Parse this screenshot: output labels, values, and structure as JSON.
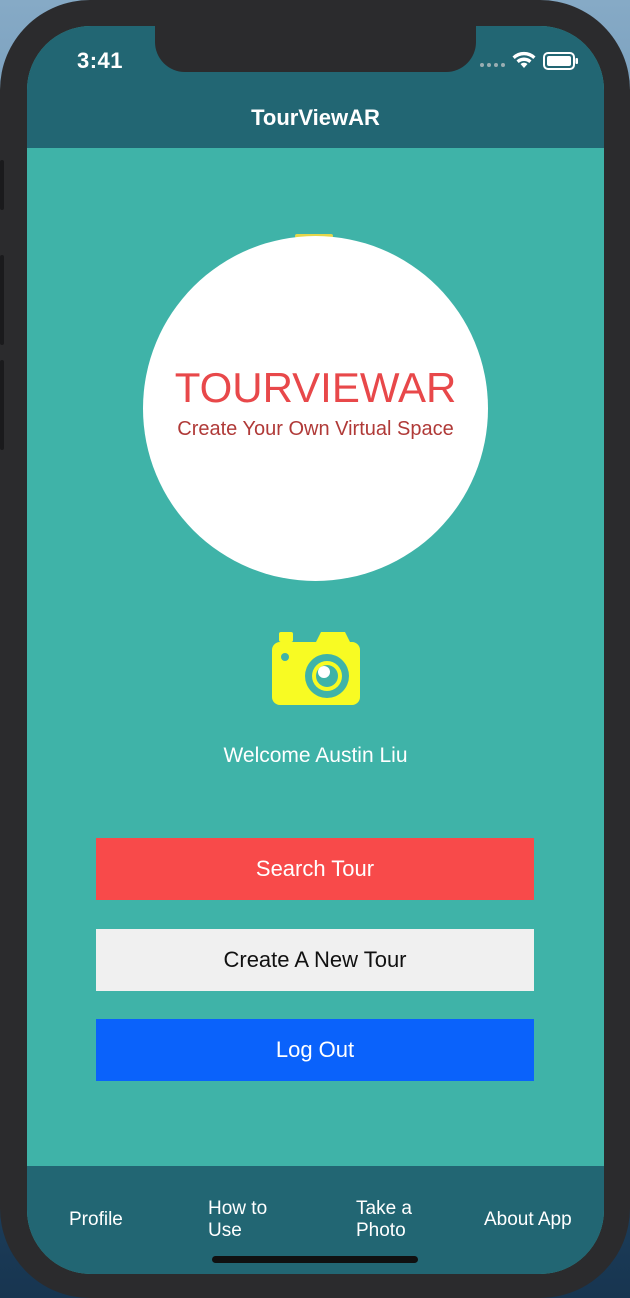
{
  "status_bar": {
    "time": "3:41"
  },
  "nav": {
    "title": "TourViewAR"
  },
  "logo": {
    "title": "TOURVIEWAR",
    "tagline": "Create Your Own Virtual Space"
  },
  "welcome_text": "Welcome Austin Liu",
  "buttons": {
    "search": "Search Tour",
    "create": "Create A New Tour",
    "logout": "Log Out"
  },
  "tabs": [
    {
      "label": "Profile"
    },
    {
      "label": "How to Use"
    },
    {
      "label": "Take a Photo"
    },
    {
      "label": "About App"
    }
  ],
  "colors": {
    "background": "#3fb3a8",
    "nav_bar": "#226673",
    "search_button": "#f84a4a",
    "create_button": "#f0f0f0",
    "logout_button": "#0a62fb",
    "camera_icon": "#f8fb23"
  },
  "icons": [
    "wifi-icon",
    "battery-icon",
    "camera-icon"
  ]
}
